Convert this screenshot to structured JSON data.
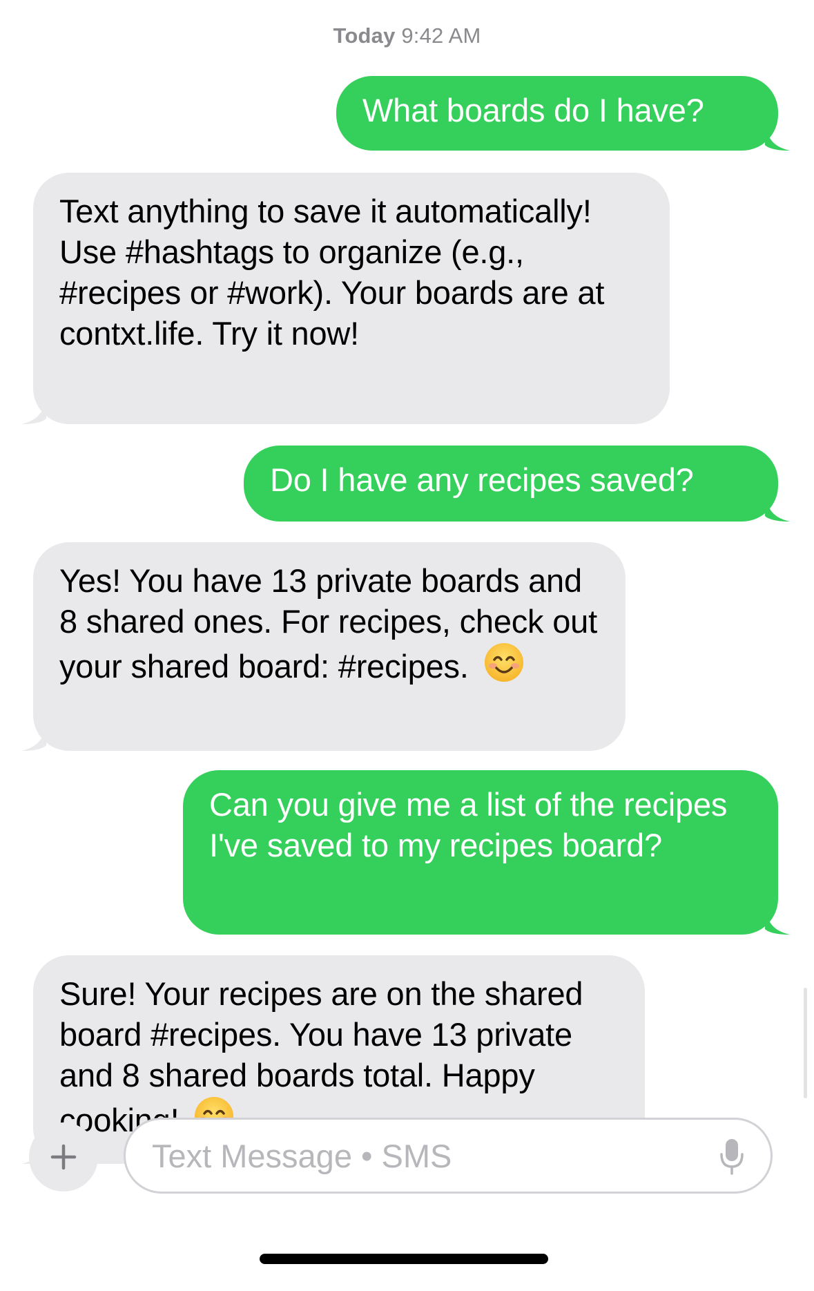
{
  "header": {
    "timestamp_day": "Today",
    "timestamp_time": "9:42 AM"
  },
  "messages": [
    {
      "direction": "outgoing",
      "text": "What boards do I have?"
    },
    {
      "direction": "incoming",
      "text": "Text anything to save it automatically! Use #hashtags to organize (e.g., #recipes or #work). Your boards are at contxt.life. Try it now!"
    },
    {
      "direction": "outgoing",
      "text": "Do I have any recipes saved?"
    },
    {
      "direction": "incoming",
      "text": "Yes! You have 13 private boards and 8 shared ones. For recipes, check out your shared board: #recipes.",
      "emoji": "smiling-face-icon"
    },
    {
      "direction": "outgoing",
      "text": "Can you give me a list of the recipes I've saved to my recipes board?"
    },
    {
      "direction": "incoming",
      "text": "Sure! Your recipes are on the shared board #recipes. You have 13 private and 8 shared boards total. Happy cooking!",
      "emoji": "smiling-face-icon"
    }
  ],
  "composer": {
    "placeholder": "Text Message • SMS",
    "add_icon": "plus-icon",
    "mic_icon": "microphone-icon"
  },
  "colors": {
    "outgoing_bubble": "#35d05b",
    "incoming_bubble": "#e9e9eb",
    "timestamp_text": "#8a8a8e"
  }
}
